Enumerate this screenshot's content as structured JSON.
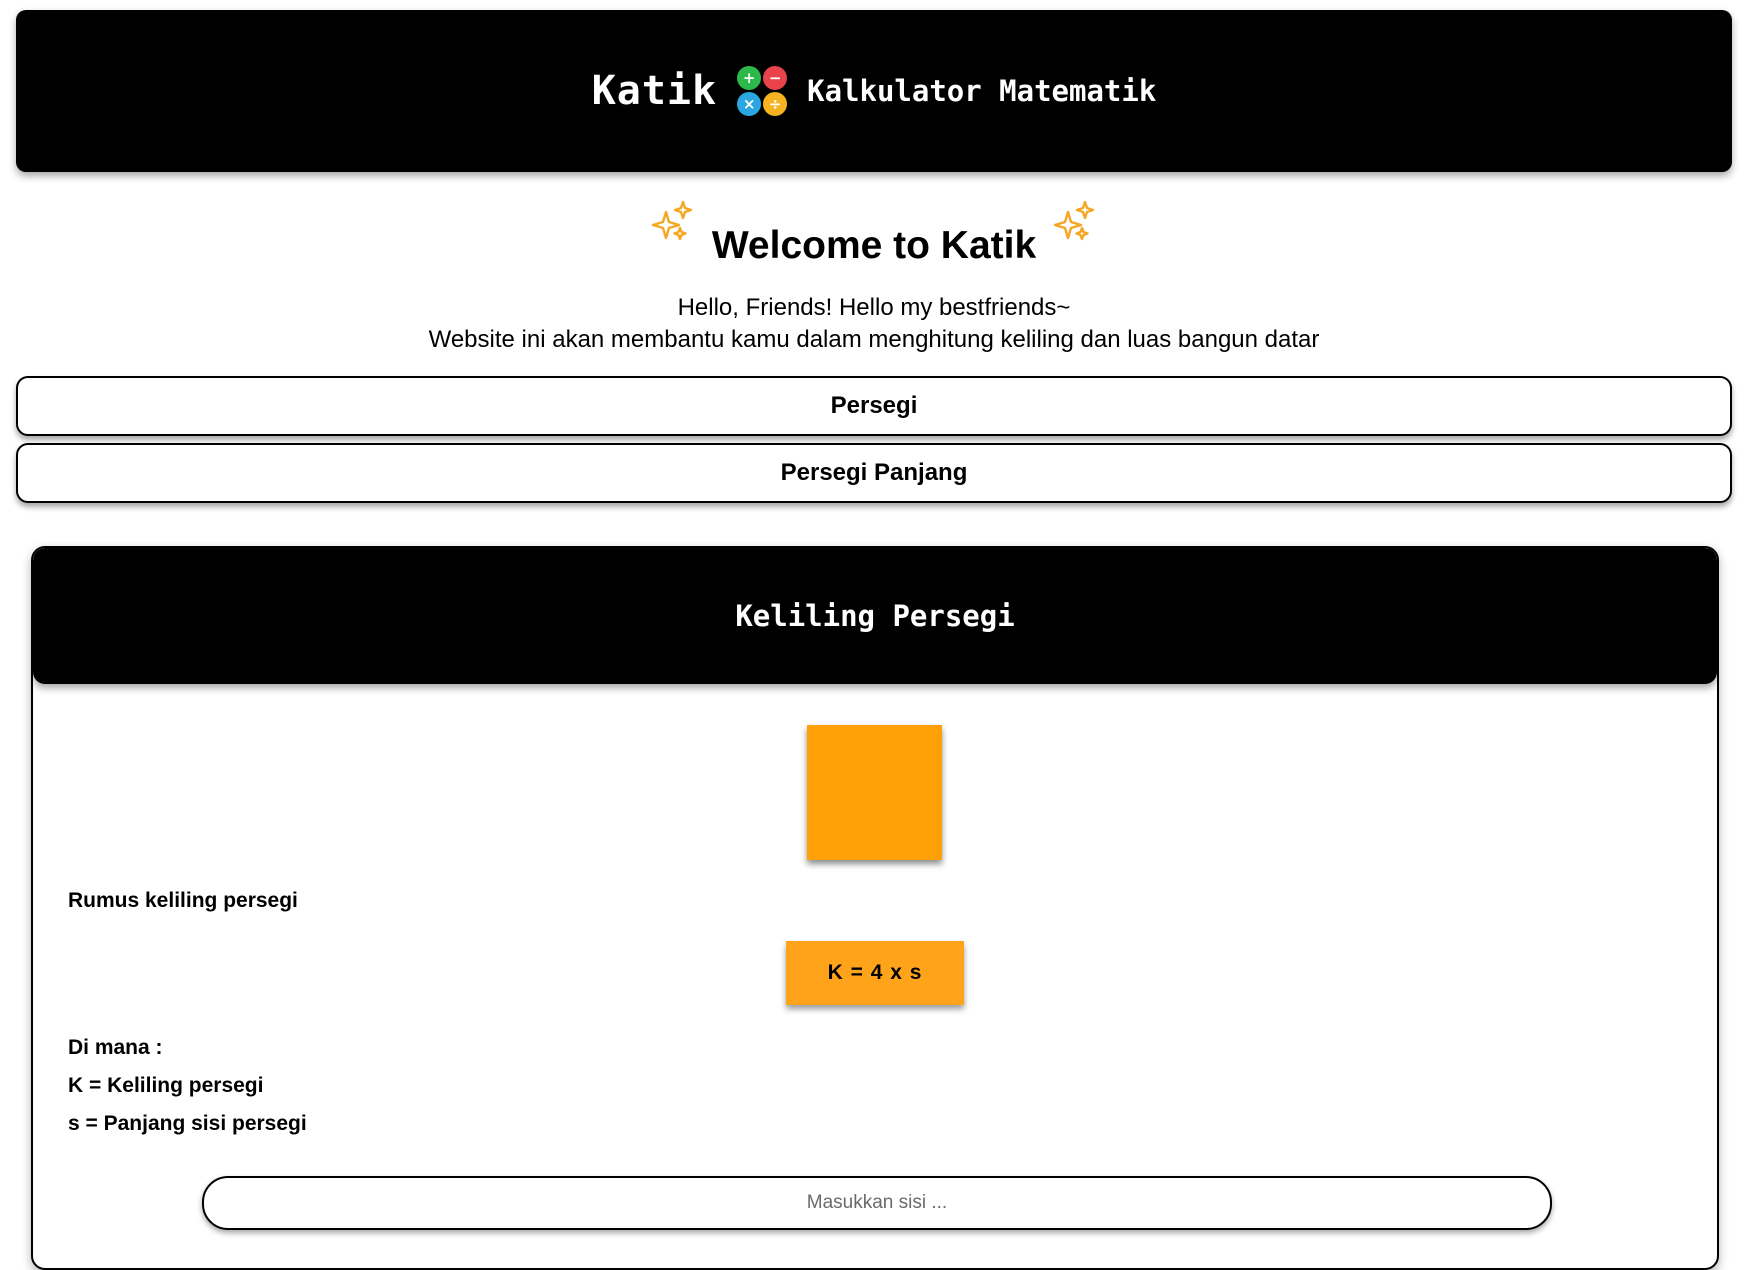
{
  "header": {
    "brand": "Katik",
    "subtitle": "Kalkulator Matematik",
    "logo_icon": "calculator-operators-icon",
    "logo_symbols": [
      "+",
      "−",
      "×",
      "÷"
    ],
    "logo_colors": [
      "#2db84a",
      "#e8424a",
      "#2aa6e0",
      "#f5b321"
    ]
  },
  "welcome": {
    "title": "Welcome to Katik",
    "sparkle_icon": "sparkles-icon",
    "sparkle_color": "#f5a623",
    "greeting": "Hello, Friends! Hello my bestfriends~",
    "description": "Website ini akan membantu kamu dalam menghitung keliling dan luas bangun datar"
  },
  "shapes": [
    {
      "label": "Persegi"
    },
    {
      "label": "Persegi Panjang"
    }
  ],
  "card": {
    "title": "Keliling Persegi",
    "square_color": "#ffa008",
    "formula_heading": "Rumus keliling persegi",
    "formula": "K = 4 x s",
    "where_heading": "Di mana :",
    "legend": [
      "K = Keliling persegi",
      "s = Panjang sisi persegi"
    ],
    "input": {
      "value": "",
      "placeholder": "Masukkan sisi ..."
    }
  }
}
